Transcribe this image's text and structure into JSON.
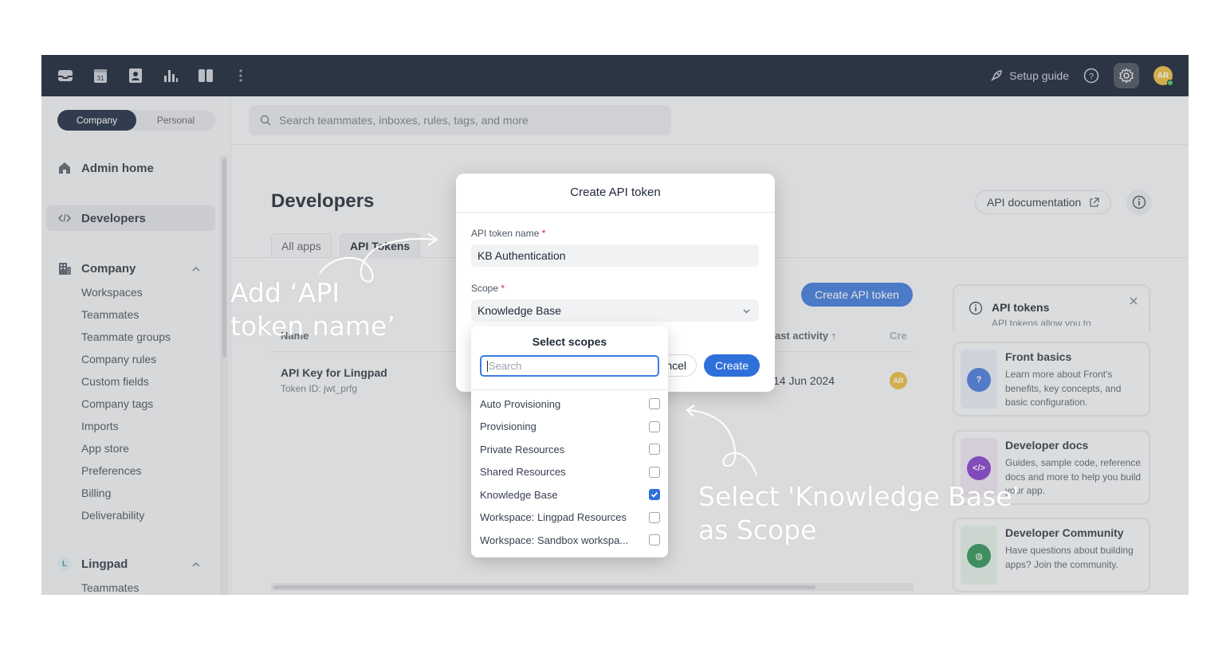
{
  "topbar": {
    "icons": [
      "inbox-icon",
      "calendar-icon",
      "contacts-icon",
      "analytics-icon",
      "knowledge-base-icon",
      "more-vertical-icon"
    ],
    "calendar_day": "31",
    "setup_guide": "Setup guide",
    "avatar_initials": "AR"
  },
  "sidebar": {
    "segment": {
      "company": "Company",
      "personal": "Personal",
      "selected": "Company"
    },
    "admin_home": "Admin home",
    "developers": "Developers",
    "company_section": "Company",
    "company_items": [
      "Workspaces",
      "Teammates",
      "Teammate groups",
      "Company rules",
      "Custom fields",
      "Company tags",
      "Imports",
      "App store",
      "Preferences",
      "Billing",
      "Deliverability"
    ],
    "workspace_section": "Lingpad",
    "workspace_badge": "L",
    "workspace_items": [
      "Teammates"
    ]
  },
  "search": {
    "placeholder": "Search teammates, inboxes, rules, tags, and more"
  },
  "main": {
    "title": "Developers",
    "api_documentation": "API documentation",
    "tabs": [
      "All apps",
      "API Tokens"
    ],
    "selected_tab": "API Tokens",
    "create_api_token": "Create API token",
    "columns": {
      "name": "Name",
      "last_activity": "Last activity ↑",
      "created_by": "Cre"
    },
    "rows": [
      {
        "name": "API Key for Lingpad",
        "token_id": "Token ID: jwt_prfg",
        "last_activity": "14 Jun 2024",
        "creator_initials": "AR"
      }
    ]
  },
  "right_panel": {
    "header_title": "API tokens",
    "header_sub": "API tokens allow you to",
    "cards": [
      {
        "title": "Front basics",
        "desc": "Learn more about Front's benefits, key concepts, and basic configuration.",
        "icon": "question-icon",
        "color": "#3a6fd8",
        "bg": "#e3e9f5"
      },
      {
        "title": "Developer docs",
        "desc": "Guides, sample code, reference docs and more to help you build your app.",
        "icon": "code-icon",
        "color": "#7b2fc9",
        "bg": "#ece3f3"
      },
      {
        "title": "Developer Community",
        "desc": "Have questions about building apps? Join the community.",
        "icon": "globe-icon",
        "color": "#1f8a4c",
        "bg": "#e1efe6"
      }
    ]
  },
  "modal": {
    "title": "Create API token",
    "name_label": "API token name",
    "name_value": "KB Authentication",
    "scope_label": "Scope",
    "scope_value": "Knowledge Base",
    "cancel": "Cancel",
    "cancel_visible": "ncel",
    "create": "Create",
    "required_mark": "*"
  },
  "scopes_dropdown": {
    "title": "Select scopes",
    "search_placeholder": "Search",
    "options": [
      {
        "label": "Auto Provisioning",
        "checked": false
      },
      {
        "label": "Provisioning",
        "checked": false
      },
      {
        "label": "Private Resources",
        "checked": false
      },
      {
        "label": "Shared Resources",
        "checked": false
      },
      {
        "label": "Knowledge Base",
        "checked": true
      },
      {
        "label": "Workspace: Lingpad Resources",
        "checked": false
      },
      {
        "label": "Workspace: Sandbox workspa...",
        "checked": false
      }
    ]
  },
  "annotations": {
    "add_name": [
      "Add ‘API",
      "token name’"
    ],
    "select_scope": [
      "Select 'Knowledge Base'",
      "as Scope"
    ]
  },
  "colors": {
    "accent": "#2f6fd9",
    "topbar": "#021025",
    "required": "#e11d48"
  }
}
